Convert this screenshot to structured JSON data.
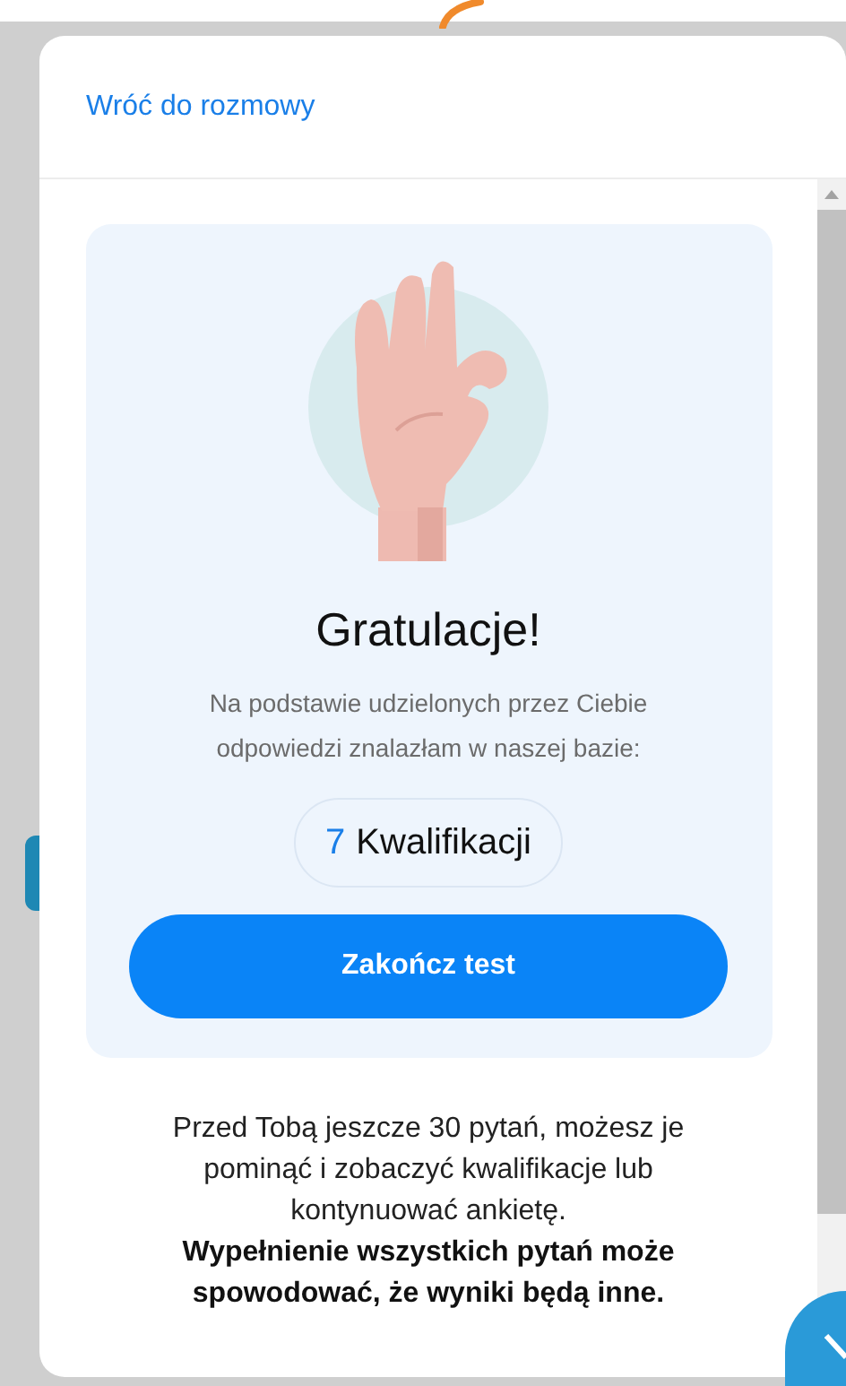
{
  "header": {
    "back_link": "Wróć do rozmowy"
  },
  "result_card": {
    "title": "Gratulacje!",
    "subtitle": "Na podstawie udzielonych przez Ciebie odpowiedzi znalazłam w naszej bazie:",
    "count": "7",
    "count_label": "Kwalifikacji",
    "finish_button": "Zakończ test"
  },
  "note": "Przed Tobą jeszcze 30 pytań, możesz je pominąć i zobaczyć kwalifikacje lub kontynuować ankietę.",
  "warning": "Wypełnienie wszystkich pytań może spowodować, że wyniki będą inne."
}
